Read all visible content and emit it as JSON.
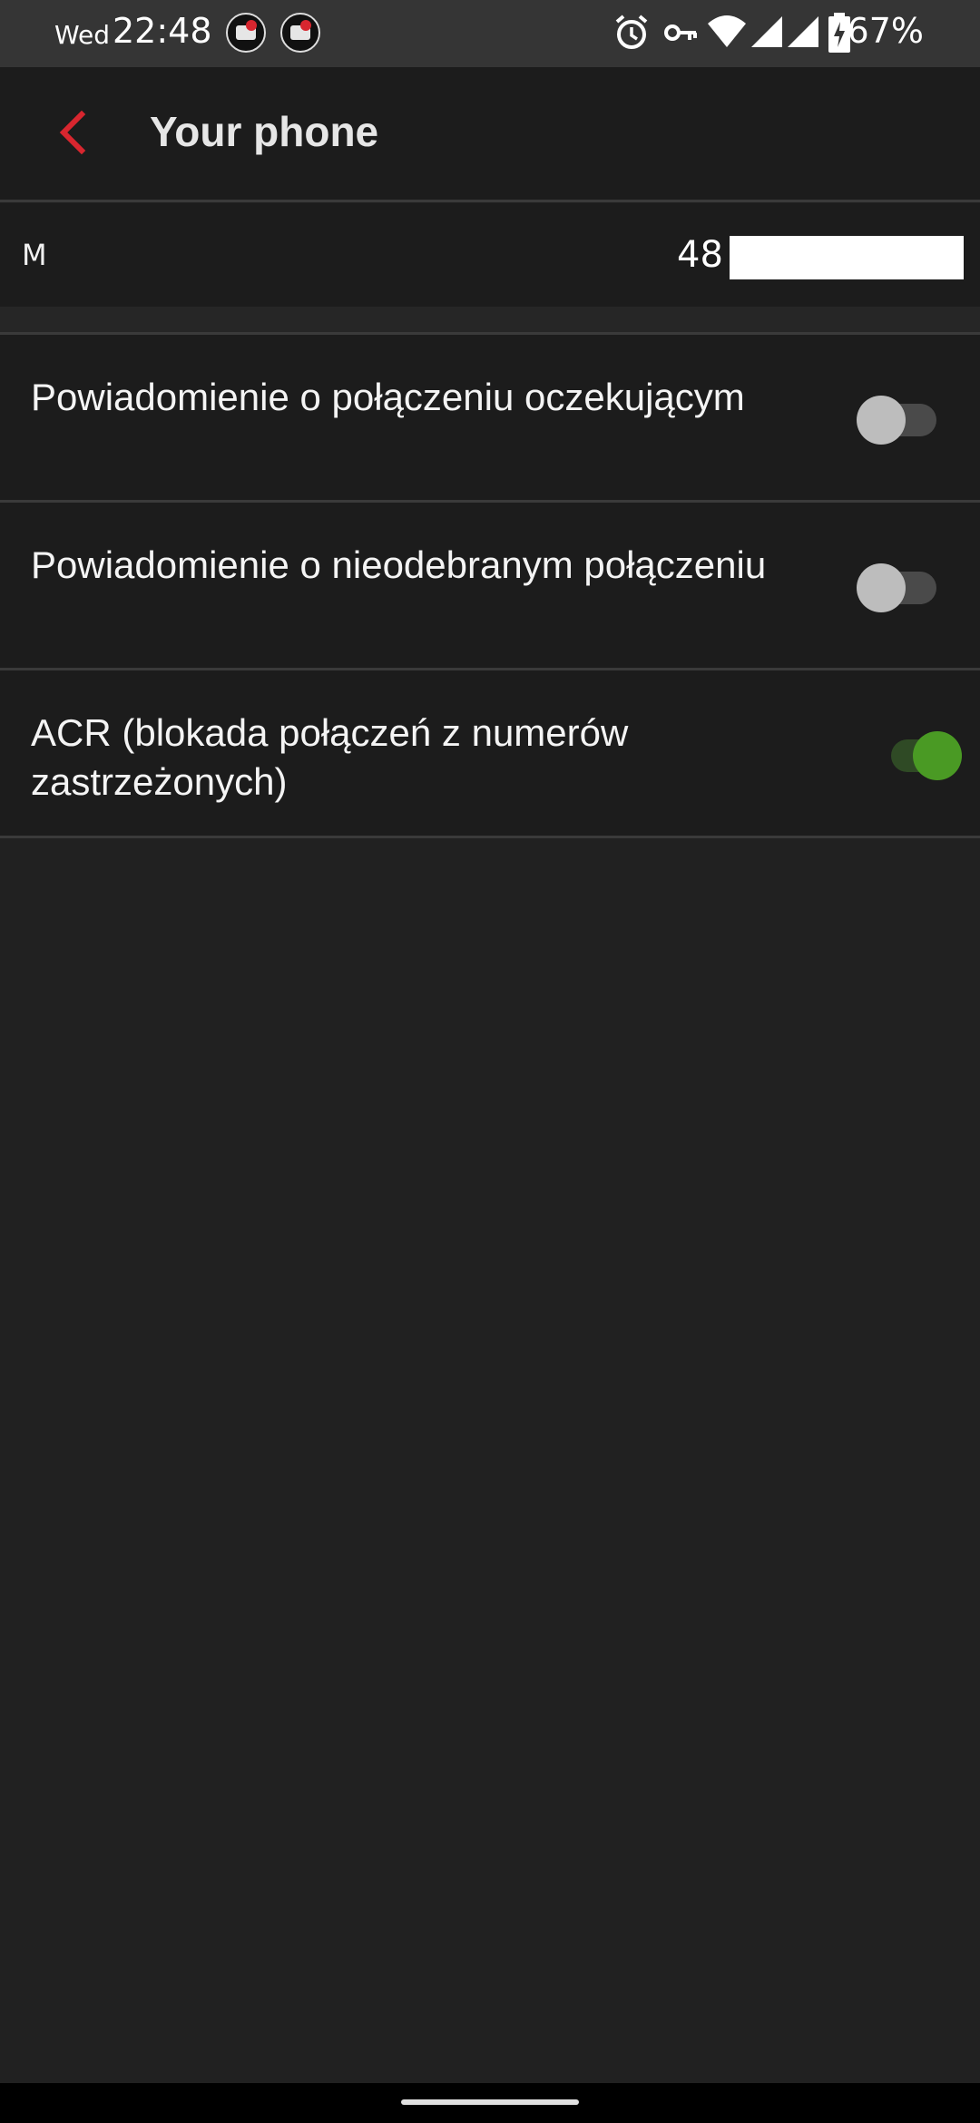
{
  "status_bar": {
    "day": "Wed",
    "time": "22:48",
    "battery_percent": "67%",
    "icons": [
      "alarm-icon",
      "vpn-key-icon",
      "wifi-icon",
      "signal-icon",
      "signal-icon",
      "battery-charging-icon"
    ]
  },
  "app_bar": {
    "title": "Your phone",
    "back_icon": "chevron-left-icon",
    "accent_color": "#d8262f"
  },
  "number_row": {
    "label": "M",
    "phone_prefix": "48"
  },
  "settings": [
    {
      "label": "Powiadomienie o połączeniu oczekującym",
      "enabled": false
    },
    {
      "label": "Powiadomienie o nieodebranym połączeniu",
      "enabled": false
    },
    {
      "label": "ACR (blokada połączeń z numerów zastrzeżonych)",
      "enabled": true
    }
  ],
  "colors": {
    "toggle_on": "#4a9a24",
    "toggle_off": "#bdbdbd",
    "background": "#212121"
  }
}
